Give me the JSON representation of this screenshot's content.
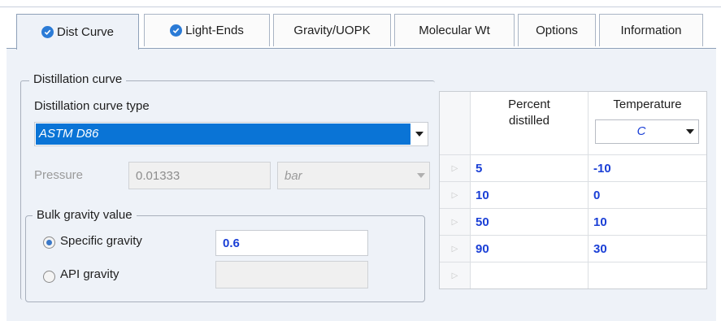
{
  "tabs": [
    {
      "label": "Dist Curve",
      "checked": true,
      "active": true
    },
    {
      "label": "Light-Ends",
      "checked": true,
      "active": false
    },
    {
      "label": "Gravity/UOPK",
      "checked": false,
      "active": false
    },
    {
      "label": "Molecular Wt",
      "checked": false,
      "active": false
    },
    {
      "label": "Options",
      "checked": false,
      "active": false
    },
    {
      "label": "Information",
      "checked": false,
      "active": false
    }
  ],
  "distillation": {
    "group_title": "Distillation curve",
    "type_label": "Distillation curve type",
    "type_value": "ASTM D86",
    "pressure_label": "Pressure",
    "pressure_value": "0.01333",
    "pressure_unit": "bar"
  },
  "bulk_gravity": {
    "group_title": "Bulk gravity value",
    "specific_label": "Specific gravity",
    "specific_value": "0.6",
    "specific_selected": true,
    "api_label": "API gravity",
    "api_value": ""
  },
  "grid": {
    "col1_header": "Percent distilled",
    "col1_header_line1": "Percent",
    "col1_header_line2": "distilled",
    "col2_header": "Temperature",
    "temp_unit": "C",
    "rows": [
      {
        "percent": "5",
        "temp": "-10"
      },
      {
        "percent": "10",
        "temp": "0"
      },
      {
        "percent": "50",
        "temp": "10"
      },
      {
        "percent": "90",
        "temp": "30"
      },
      {
        "percent": "",
        "temp": ""
      }
    ]
  },
  "colors": {
    "accent": "#0a74d6",
    "value_text": "#1a3fd6",
    "panel_bg": "#eef2f8"
  }
}
